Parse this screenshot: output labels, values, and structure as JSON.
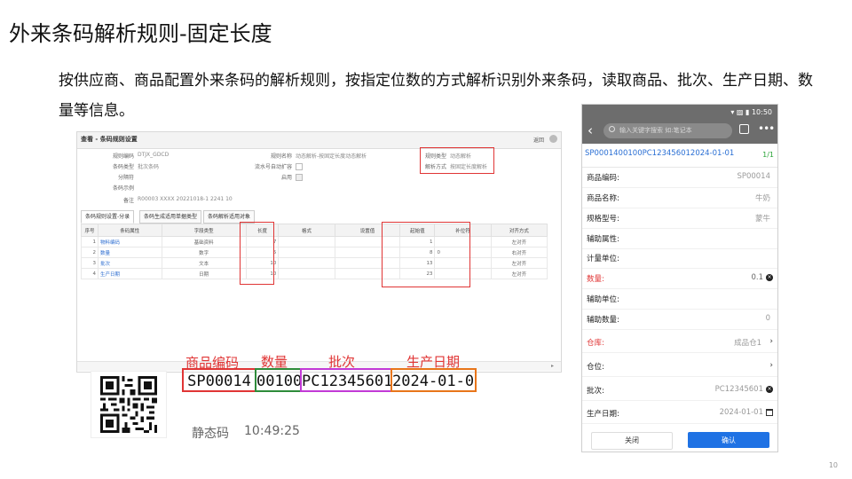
{
  "slide": {
    "title": "外来条码解析规则-固定长度",
    "description": "按供应商、商品配置外来条码的解析规则，按指定位数的方式解析识别外来条码，读取商品、批次、生产日期、数量等信息。",
    "page_number": "10"
  },
  "erp": {
    "title": "查看 - 条码规则设置",
    "back_label": "返回",
    "fields": {
      "rule_code_label": "规则编码",
      "rule_code": "DTJX_GDCD",
      "rule_name_label": "规则名称",
      "rule_name": "动态解析-按固定长度动态解析",
      "rule_type_label": "规则类型",
      "rule_type": "动态解析",
      "barcode_type_label": "条码类型",
      "barcode_type": "批次条码",
      "serial_label": "流水号自动扩容",
      "parse_mode_label": "解析方式",
      "parse_mode": "按固定长度解析",
      "separator_label": "分隔符",
      "enabled_label": "启用",
      "example_label": "条码示例",
      "remark_label": "备注",
      "remark": "R00003 XXXX 20221018-1 2241 10"
    },
    "tabs": [
      "条码规则设置-分录",
      "条码生成适用单据类型",
      "条码解析适用对象"
    ],
    "columns": [
      "序号",
      "条码属性",
      "字段类型",
      "长度",
      "格式",
      "设置值",
      "起始值",
      "补位符",
      "对齐方式"
    ],
    "rows": [
      {
        "no": "1",
        "attr": "物料编码",
        "type": "基础资料",
        "len": "7",
        "start": "1",
        "pad": "",
        "align": "左对齐"
      },
      {
        "no": "2",
        "attr": "数量",
        "type": "数字",
        "len": "5",
        "start": "8",
        "pad": "0",
        "align": "右对齐"
      },
      {
        "no": "3",
        "attr": "批次",
        "type": "文本",
        "len": "10",
        "start": "13",
        "pad": "",
        "align": "左对齐"
      },
      {
        "no": "4",
        "attr": "生产日期",
        "type": "日期",
        "len": "10",
        "start": "23",
        "pad": "",
        "align": "左对齐"
      }
    ]
  },
  "barcode": {
    "labels": [
      "商品编码",
      "数量",
      "批次",
      "生产日期"
    ],
    "segments": [
      "SP00014",
      "00100",
      "PC12345601",
      "2024-01-01"
    ],
    "colors": [
      "#e03535",
      "#2e8b3a",
      "#c23ad6",
      "#e8751a"
    ],
    "static_label": "静态码",
    "time": "10:49:25"
  },
  "phone": {
    "status_time": "10:50",
    "search_placeholder": "输入关键字搜索 如:笔记本",
    "scanned_code": "SP0001400100PC123456012024-01-01",
    "counter": "1/1",
    "fields": [
      {
        "label": "商品编码:",
        "value": "SP00014"
      },
      {
        "label": "商品名称:",
        "value": "牛奶"
      },
      {
        "label": "规格型号:",
        "value": "蒙牛"
      },
      {
        "label": "辅助属性:",
        "value": ""
      },
      {
        "label": "计量单位:",
        "value": ""
      },
      {
        "label": "数量:",
        "value": "0.1"
      },
      {
        "label": "辅助单位:",
        "value": ""
      },
      {
        "label": "辅助数量:",
        "value": "0"
      },
      {
        "label": "仓库:",
        "value": "成品仓1"
      },
      {
        "label": "仓位:",
        "value": ""
      },
      {
        "label": "批次:",
        "value": "PC12345601"
      },
      {
        "label": "生产日期:",
        "value": "2024-01-01"
      }
    ],
    "close_label": "关闭",
    "ok_label": "确认"
  }
}
